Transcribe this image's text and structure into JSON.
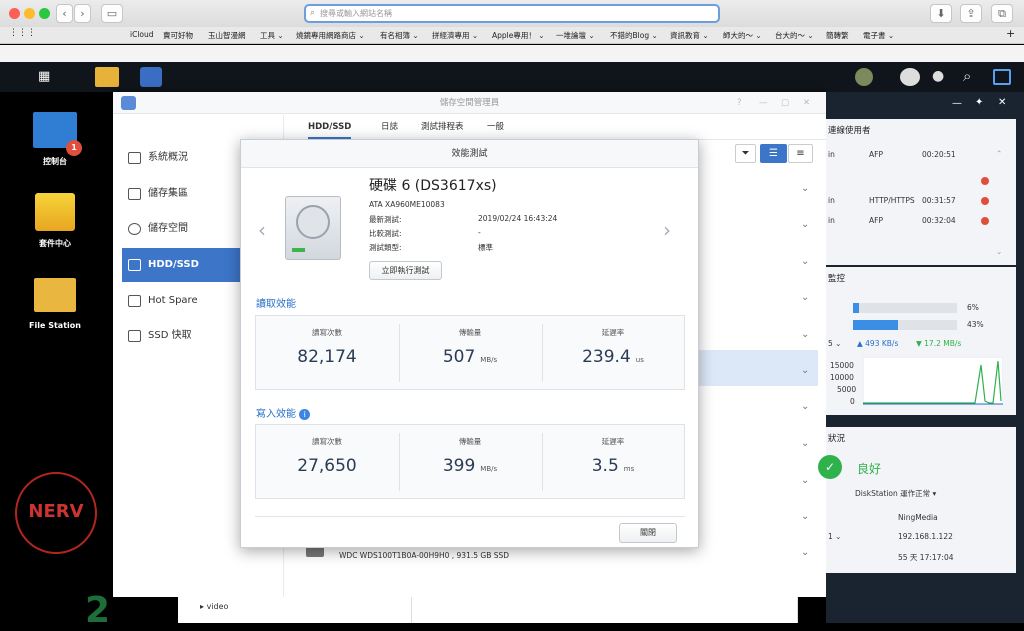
{
  "browser": {
    "url_placeholder": "搜尋或輸入網站名稱",
    "bookmarks": [
      "iCloud",
      "賣可好物",
      "玉山智漫網",
      "工具 ⌄",
      "燒鏡專用網路商店 ⌄",
      "有名相簿 ⌄",
      "拼經濟專用 ⌄",
      "Apple專用！ ⌄",
      "一堆論壇 ⌄",
      "不錯的Blog ⌄",
      "資訊教育 ⌄",
      "師大的～ ⌄",
      "台大的～ ⌄",
      "簡轉繁",
      "電子書 ⌄"
    ]
  },
  "desktop": {
    "icons": [
      {
        "label": "控制台",
        "badge": "1"
      },
      {
        "label": "套件中心"
      },
      {
        "label": "File Station"
      }
    ]
  },
  "storage_manager": {
    "title": "儲存空間管理員",
    "sidebar": [
      {
        "label": "系統概況"
      },
      {
        "label": "儲存集區"
      },
      {
        "label": "儲存空間"
      },
      {
        "label": "HDD/SSD"
      },
      {
        "label": "Hot Spare"
      },
      {
        "label": "SSD 快取"
      }
    ],
    "tabs": [
      "HDD/SSD",
      "日誌",
      "測試排程表",
      "一般"
    ],
    "bottom_disk": "WDC WDS100T1B0A-00H9H0 , 931.5 GB SSD",
    "tree_item": "video"
  },
  "modal": {
    "title": "效能測試",
    "disk_name": "硬碟 6 (DS3617xs)",
    "model": "ATA XA960ME10083",
    "fields": [
      {
        "label": "最新測試:",
        "value": "2019/02/24 16:43:24"
      },
      {
        "label": "比較測試:",
        "value": "-"
      },
      {
        "label": "測試類型:",
        "value": "標準"
      }
    ],
    "run_button": "立即執行測試",
    "read_title": "讀取效能",
    "write_title": "寫入效能",
    "read_stats": [
      {
        "label": "讀寫次數",
        "value": "82,174",
        "unit": ""
      },
      {
        "label": "傳輸量",
        "value": "507",
        "unit": "MB/s"
      },
      {
        "label": "延遲率",
        "value": "239.4",
        "unit": "us"
      }
    ],
    "write_stats": [
      {
        "label": "讀寫次數",
        "value": "27,650",
        "unit": ""
      },
      {
        "label": "傳輸量",
        "value": "399",
        "unit": "MB/s"
      },
      {
        "label": "延遲率",
        "value": "3.5",
        "unit": "ms"
      }
    ],
    "close_button": "關閉"
  },
  "widgets": {
    "connected_title": "連線使用者",
    "connections": [
      {
        "user": "in",
        "proto": "AFP",
        "time": "00:20:51"
      },
      {
        "user": "in",
        "proto": "HTTP/HTTPS",
        "time": "00:31:57"
      },
      {
        "user": "in",
        "proto": "AFP",
        "time": "00:32:04"
      }
    ],
    "monitor_title": "監控",
    "cpu_pct": "6%",
    "ram_pct": "43%",
    "cpu_fraction": 0.06,
    "ram_fraction": 0.43,
    "net_prefix": "5 ⌄",
    "upload": "493 KB/s",
    "download": "17.2 MB/s",
    "y_ticks": [
      "15000",
      "10000",
      "5000",
      "0"
    ],
    "health_title": "狀況",
    "health_status": "良好",
    "health_desc": "DiskStation 運作正常 ▾",
    "server_name": "NingMedia",
    "ip_label": "1 ⌄",
    "ip": "192.168.1.122",
    "uptime": "55 天 17:17:04"
  },
  "colors": {
    "accent": "#3d75c9",
    "ok": "#2fb14b",
    "error": "#e04e3c"
  }
}
